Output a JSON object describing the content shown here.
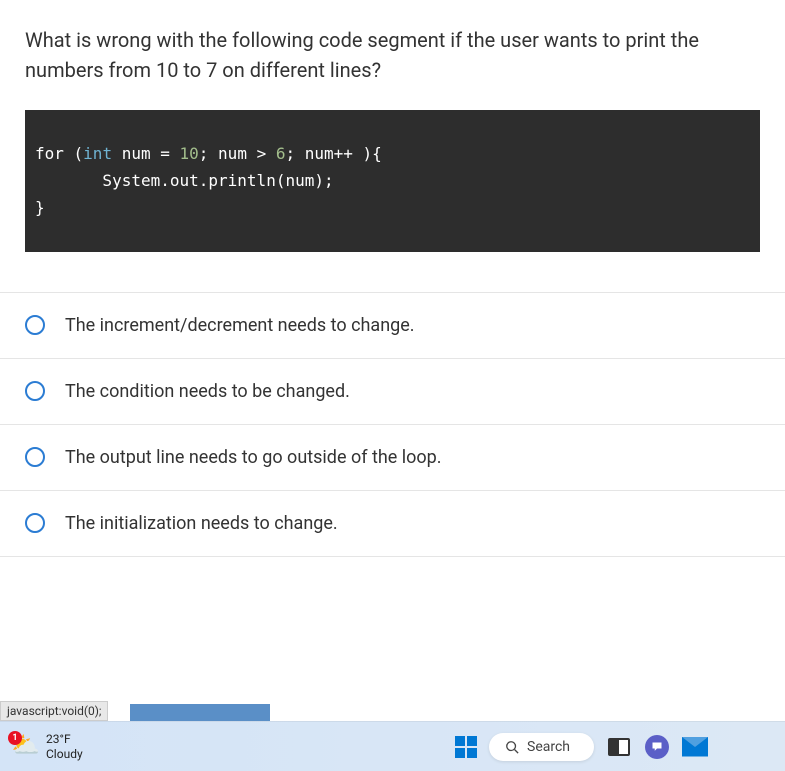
{
  "question": "What is wrong with the following code segment if the user wants to print the numbers from 10 to 7 on different lines?",
  "code": {
    "line1_pre": "for (",
    "line1_type": "int",
    "line1_mid1": " num = ",
    "line1_num1": "10",
    "line1_mid2": "; num > ",
    "line1_num2": "6",
    "line1_post": "; num++ ){",
    "line2": "       System.out.println(num);",
    "line3": "}"
  },
  "answers": [
    "The increment/decrement needs to change.",
    "The condition needs to be changed.",
    "The output line needs to go outside of the loop.",
    "The initialization needs to change."
  ],
  "status": "javascript:void(0);",
  "taskbar": {
    "weather_badge": "1",
    "temp": "23°F",
    "condition": "Cloudy",
    "search": "Search"
  }
}
